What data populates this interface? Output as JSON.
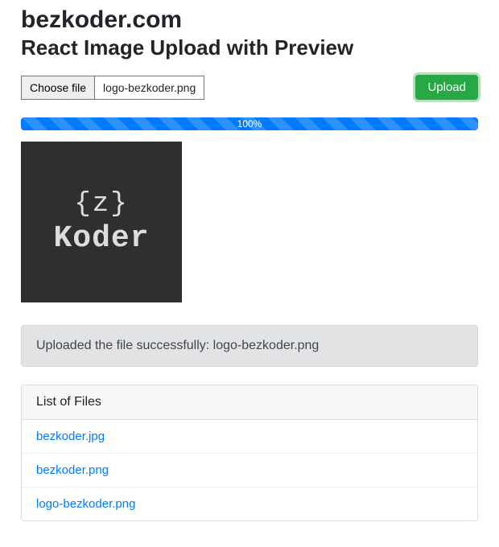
{
  "site_name": "bezkoder.com",
  "page_title": "React Image Upload with Preview",
  "file_input": {
    "choose_label": "Choose file",
    "selected_file": "logo-bezkoder.png"
  },
  "upload_button_label": "Upload",
  "progress": {
    "percent_text": "100%"
  },
  "preview_logo": {
    "line1": "{z}",
    "line2": "Koder"
  },
  "alert_message": "Uploaded the file successfully: logo-bezkoder.png",
  "files_header": "List of Files",
  "files": [
    {
      "name": "bezkoder.jpg"
    },
    {
      "name": "bezkoder.png"
    },
    {
      "name": "logo-bezkoder.png"
    }
  ]
}
